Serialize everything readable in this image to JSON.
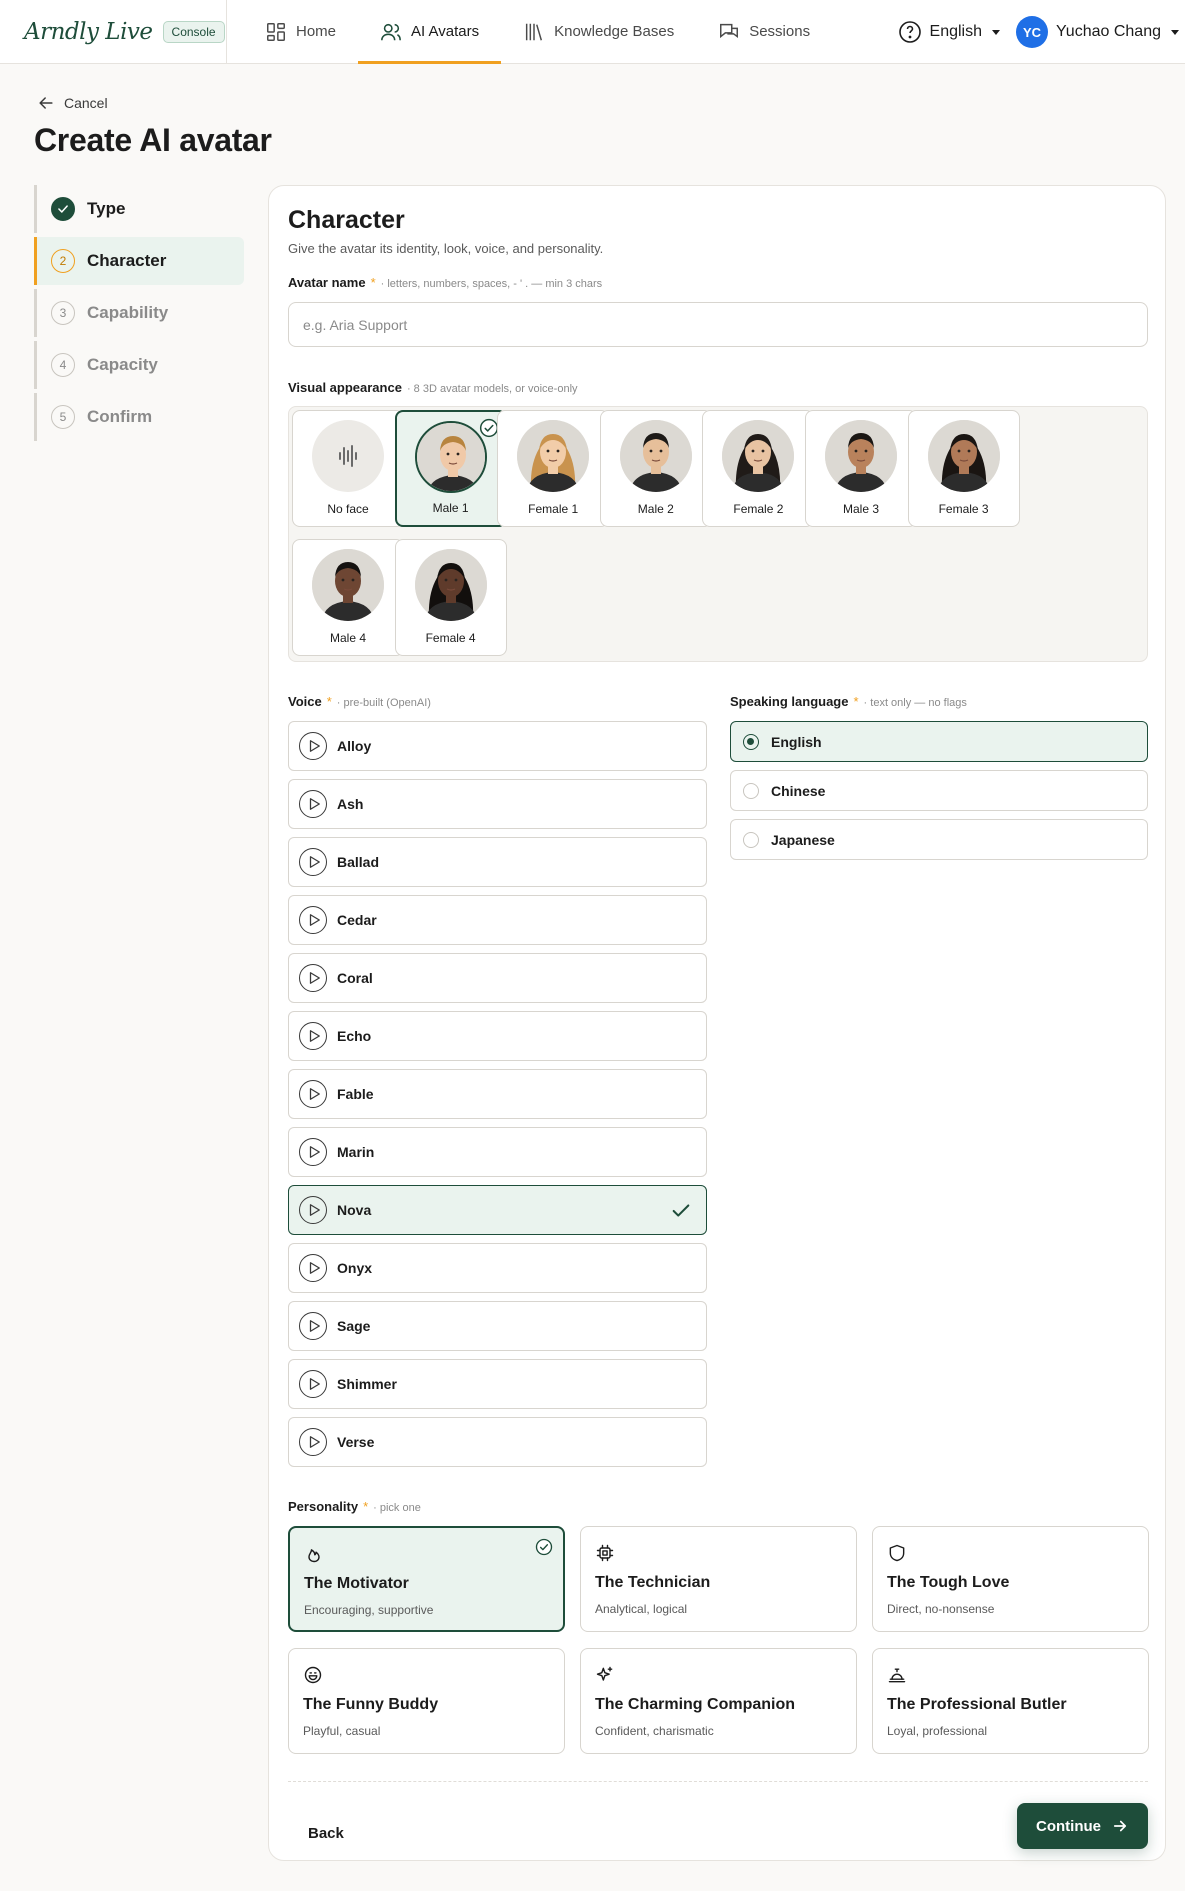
{
  "brand": {
    "logo": "Arndly Live",
    "badge": "Console"
  },
  "nav": {
    "tabs": [
      {
        "label": "Home",
        "icon": "grid-icon"
      },
      {
        "label": "AI Avatars",
        "icon": "users-icon",
        "active": true
      },
      {
        "label": "Knowledge Bases",
        "icon": "library-icon"
      },
      {
        "label": "Sessions",
        "icon": "chat-icon"
      }
    ],
    "language": "English",
    "user": {
      "initials": "YC",
      "name": "Yuchao Chang"
    }
  },
  "header": {
    "cancel_label": "Cancel",
    "title": "Create AI avatar"
  },
  "stepper": {
    "steps": [
      {
        "num": "1",
        "label": "Type",
        "state": "done"
      },
      {
        "num": "2",
        "label": "Character",
        "state": "current"
      },
      {
        "num": "3",
        "label": "Capability",
        "state": "todo"
      },
      {
        "num": "4",
        "label": "Capacity",
        "state": "todo"
      },
      {
        "num": "5",
        "label": "Confirm",
        "state": "todo"
      }
    ]
  },
  "form": {
    "title": "Character",
    "subtitle": "Give the avatar its identity, look, voice, and personality.",
    "name": {
      "label": "Avatar name",
      "required": "*",
      "hint": "· letters, numbers, spaces, - ' . — min 3 chars",
      "placeholder": "e.g. Aria Support",
      "value": ""
    },
    "appearance": {
      "label": "Visual appearance",
      "hint": "· 8 3D avatar models, or voice-only",
      "selected": "Male 1",
      "options": [
        {
          "label": "No face",
          "kind": "none"
        },
        {
          "label": "Male 1",
          "skin": "#f0c9a8",
          "hair": "#b8843e"
        },
        {
          "label": "Female 1",
          "skin": "#f2cda9",
          "hair": "#c9934e"
        },
        {
          "label": "Male 2",
          "skin": "#e6bf9a",
          "hair": "#1d1a17"
        },
        {
          "label": "Female 2",
          "skin": "#e8c3a2",
          "hair": "#201b18"
        },
        {
          "label": "Male 3",
          "skin": "#b9825c",
          "hair": "#1b1714"
        },
        {
          "label": "Female 3",
          "skin": "#b07a58",
          "hair": "#1a1512"
        },
        {
          "label": "Male 4",
          "skin": "#6e4633",
          "hair": "#151210"
        },
        {
          "label": "Female 4",
          "skin": "#5f3b2b",
          "hair": "#120f0d"
        }
      ]
    },
    "voice": {
      "label": "Voice",
      "required": "*",
      "hint": "· pre-built (OpenAI)",
      "selected": "Nova",
      "options": [
        "Alloy",
        "Ash",
        "Ballad",
        "Cedar",
        "Coral",
        "Echo",
        "Fable",
        "Marin",
        "Nova",
        "Onyx",
        "Sage",
        "Shimmer",
        "Verse"
      ]
    },
    "language": {
      "label": "Speaking language",
      "required": "*",
      "hint": "· text only — no flags",
      "selected": "English",
      "options": [
        "English",
        "Chinese",
        "Japanese"
      ]
    },
    "personality": {
      "label": "Personality",
      "required": "*",
      "hint": "· pick one",
      "selected": "The Motivator",
      "options": [
        {
          "title": "The Motivator",
          "desc": "Encouraging, supportive",
          "icon": "flame-icon"
        },
        {
          "title": "The Technician",
          "desc": "Analytical, logical",
          "icon": "chip-icon"
        },
        {
          "title": "The Tough Love",
          "desc": "Direct, no-nonsense",
          "icon": "shield-icon"
        },
        {
          "title": "The Funny Buddy",
          "desc": "Playful, casual",
          "icon": "laugh-icon"
        },
        {
          "title": "The Charming Companion",
          "desc": "Confident, charismatic",
          "icon": "sparkles-icon"
        },
        {
          "title": "The Professional Butler",
          "desc": "Loyal, professional",
          "icon": "bell-icon"
        }
      ]
    }
  },
  "footer": {
    "back_label": "Back",
    "continue_label": "Continue"
  },
  "colors": {
    "brand": "#1e4d3a",
    "accent": "#f0a020",
    "selected_bg": "#eaf3ee"
  }
}
